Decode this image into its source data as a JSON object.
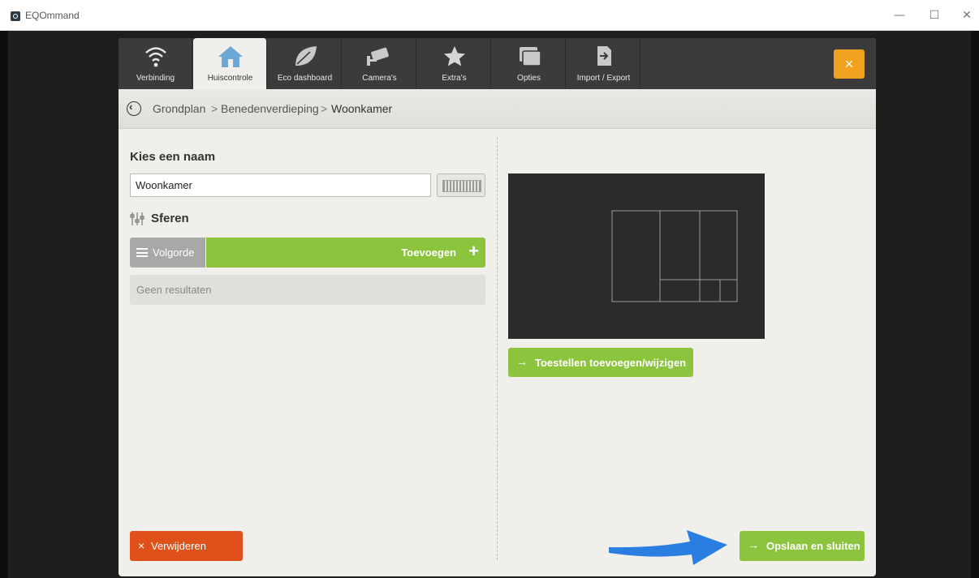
{
  "window": {
    "title": "EQOmmand",
    "minimize": "—",
    "maximize": "☐",
    "close": "✕"
  },
  "tabs": [
    {
      "label": "Verbinding",
      "icon": "wifi-icon"
    },
    {
      "label": "Huiscontrole",
      "icon": "home-icon",
      "active": true
    },
    {
      "label": "Eco dashboard",
      "icon": "leaf-icon"
    },
    {
      "label": "Camera's",
      "icon": "camera-icon"
    },
    {
      "label": "Extra's",
      "icon": "star-icon"
    },
    {
      "label": "Opties",
      "icon": "options-icon"
    },
    {
      "label": "Import / Export",
      "icon": "import-export-icon"
    }
  ],
  "close_button": "×",
  "breadcrumb": {
    "items": [
      "Grondplan",
      "Benedenverdieping",
      "Woonkamer"
    ],
    "separator": ">"
  },
  "form": {
    "name_title": "Kies een naam",
    "name_value": "Woonkamer",
    "sferen_title": "Sferen",
    "volgorde_label": "Volgorde",
    "toevoegen_label": "Toevoegen",
    "toevoegen_plus": "+",
    "empty_text": "Geen resultaten"
  },
  "buttons": {
    "toestellen": "Toestellen toevoegen/wijzigen",
    "delete": "Verwijderen",
    "delete_icon": "×",
    "save": "Opslaan en sluiten",
    "arrow": "→"
  },
  "colors": {
    "accent_green": "#8cc43e",
    "danger": "#e0501a",
    "close_orange": "#f0a21f",
    "annotation_arrow": "#2a7de1"
  }
}
